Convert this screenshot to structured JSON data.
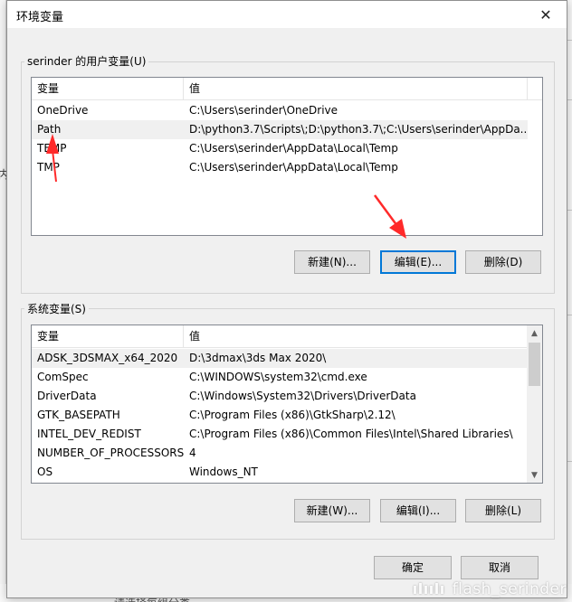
{
  "dialog": {
    "title": "环境变量",
    "close_glyph": "✕"
  },
  "user_vars": {
    "group_label": "serinder 的用户变量(U)",
    "columns": [
      "变量",
      "值"
    ],
    "rows": [
      {
        "name": "OneDrive",
        "value": "C:\\Users\\serinder\\OneDrive"
      },
      {
        "name": "Path",
        "value": "D:\\python3.7\\Scripts\\;D:\\python3.7\\;C:\\Users\\serinder\\AppDa..."
      },
      {
        "name": "TEMP",
        "value": "C:\\Users\\serinder\\AppData\\Local\\Temp"
      },
      {
        "name": "TMP",
        "value": "C:\\Users\\serinder\\AppData\\Local\\Temp"
      }
    ],
    "buttons": {
      "new": "新建(N)...",
      "edit": "编辑(E)...",
      "delete": "删除(D)"
    }
  },
  "system_vars": {
    "group_label": "系统变量(S)",
    "columns": [
      "变量",
      "值"
    ],
    "rows": [
      {
        "name": "ADSK_3DSMAX_x64_2020",
        "value": "D:\\3dmax\\3ds Max 2020\\"
      },
      {
        "name": "ComSpec",
        "value": "C:\\WINDOWS\\system32\\cmd.exe"
      },
      {
        "name": "DriverData",
        "value": "C:\\Windows\\System32\\Drivers\\DriverData"
      },
      {
        "name": "GTK_BASEPATH",
        "value": "C:\\Program Files (x86)\\GtkSharp\\2.12\\"
      },
      {
        "name": "INTEL_DEV_REDIST",
        "value": "C:\\Program Files (x86)\\Common Files\\Intel\\Shared Libraries\\"
      },
      {
        "name": "NUMBER_OF_PROCESSORS",
        "value": "4"
      },
      {
        "name": "OS",
        "value": "Windows_NT"
      }
    ],
    "buttons": {
      "new": "新建(W)...",
      "edit": "编辑(I)...",
      "delete": "删除(L)"
    }
  },
  "footer": {
    "ok": "确定",
    "cancel": "取消"
  },
  "background": {
    "left_glyph": "内",
    "bottom_text": "请选择每组分类"
  },
  "watermark": {
    "logo": "ılıılı",
    "text": "flash_serinder"
  },
  "colors": {
    "annotation_arrow": "#ff2a2a",
    "default_button_border": "#0078d7"
  }
}
